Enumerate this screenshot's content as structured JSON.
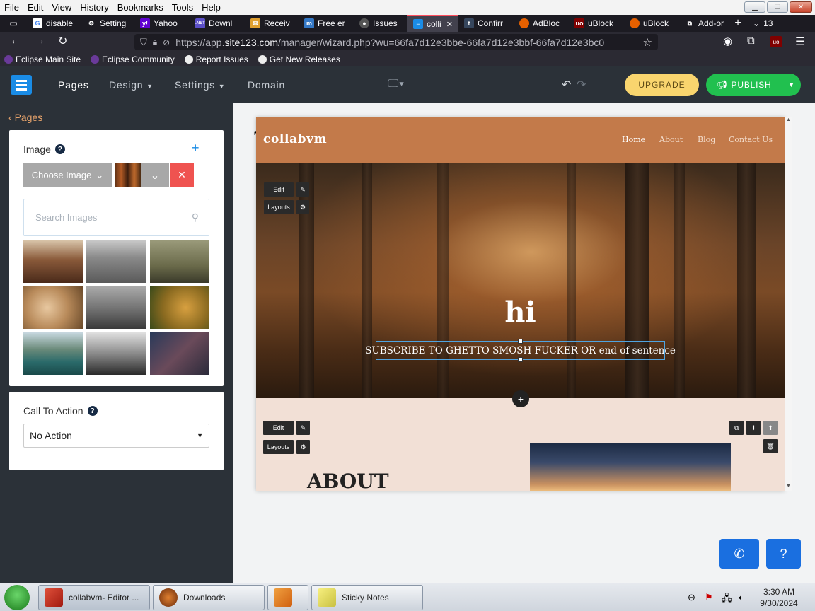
{
  "menubar": {
    "items": [
      "File",
      "Edit",
      "View",
      "History",
      "Bookmarks",
      "Tools",
      "Help"
    ]
  },
  "tabs": [
    {
      "label": "disable",
      "icon": "google-icon",
      "color": "#4285f4"
    },
    {
      "label": "Setting",
      "icon": "gear-icon",
      "color": "#cccccc"
    },
    {
      "label": "Yahoo",
      "icon": "yahoo-icon",
      "color": "#6001d2"
    },
    {
      "label": "Downl",
      "icon": "net-icon",
      "color": "#5b4fc7"
    },
    {
      "label": "Receiv",
      "icon": "mail-icon",
      "color": "#e0a030"
    },
    {
      "label": "Free er",
      "icon": "m-icon",
      "color": "#3478c6"
    },
    {
      "label": "Issues",
      "icon": "github-icon",
      "color": "#555555"
    },
    {
      "label": "colli",
      "icon": "site123-icon",
      "color": "#1a8ce6",
      "active": true
    },
    {
      "label": "Confirr",
      "icon": "tumblr-icon",
      "color": "#36465d"
    },
    {
      "label": "AdBloc",
      "icon": "firefox-icon",
      "color": "#e66000"
    },
    {
      "label": "uBlock",
      "icon": "ublock-icon",
      "color": "#800000"
    },
    {
      "label": "uBlock",
      "icon": "firefox-icon",
      "color": "#e66000"
    },
    {
      "label": "Add-or",
      "icon": "puzzle-icon",
      "color": "#cccccc"
    }
  ],
  "tab_overflow_count": "13",
  "url": {
    "prefix": "https://app.",
    "host": "site123.com",
    "path": "/manager/wizard.php?wu=66fa7d12e3bbe-66fa7d12e3bbf-66fa7d12e3bc0"
  },
  "bookmarks": [
    "Eclipse Main Site",
    "Eclipse Community",
    "Report Issues",
    "Get New Releases"
  ],
  "app_nav": {
    "pages": "Pages",
    "design": "Design",
    "settings": "Settings",
    "domain": "Domain",
    "upgrade": "UPGRADE",
    "publish": "PUBLISH"
  },
  "left_panel": {
    "back_label": "Pages",
    "image_label": "Image",
    "choose_image": "Choose Image",
    "delete_glyph": "✕",
    "search_placeholder": "Search Images",
    "cta_label": "Call To Action",
    "cta_value": "No Action"
  },
  "thumbnails": [
    {
      "name": "people-on-bench",
      "color": "#7a4a2e"
    },
    {
      "name": "city-skyline",
      "color": "#8a7a6a"
    },
    {
      "name": "guitar-player",
      "color": "#6a6a4a"
    },
    {
      "name": "food-table",
      "color": "#c89a6a"
    },
    {
      "name": "city-runner",
      "color": "#7a7a7a"
    },
    {
      "name": "roaring-lion",
      "color": "#9a7a2a"
    },
    {
      "name": "mountain-lake",
      "color": "#3a6a5a"
    },
    {
      "name": "couple-walking",
      "color": "#6a6a6a"
    },
    {
      "name": "paint-brushes",
      "color": "#3a4a6a"
    }
  ],
  "site": {
    "brand": "collabvm",
    "nav": [
      "Home",
      "About",
      "Blog",
      "Contact Us"
    ],
    "hero_title": "hi",
    "hero_subtitle": "SUBSCRIBE TO GHETTO SMOSH FUCKER OR end of sentence",
    "about_title": "ABOUT",
    "edit_label": "Edit",
    "layouts_label": "Layouts"
  },
  "taskbar": {
    "items": [
      "collabvm- Editor ...",
      "Downloads",
      "",
      "Sticky Notes"
    ],
    "time": "3:30 AM",
    "date": "9/30/2024"
  },
  "colors": {
    "accent": "#1a8ce6",
    "publish": "#21c04f",
    "upgrade": "#f9d56e",
    "site_header": "#c37a4a"
  }
}
